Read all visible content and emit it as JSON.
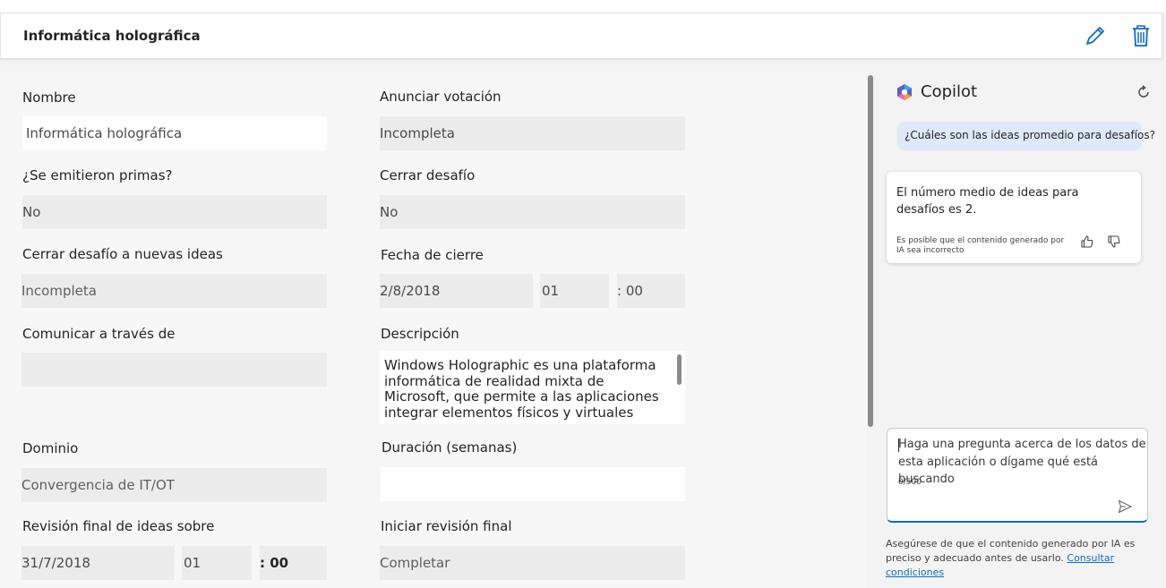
{
  "header": {
    "title": "Informática holográfica",
    "edit_icon": "pencil-icon",
    "delete_icon": "trash-icon",
    "accent": "#0f6cbd"
  },
  "form": {
    "nombre": {
      "label": "Nombre",
      "value": "Informática holográfica"
    },
    "anunciar_votacion": {
      "label": "Anunciar votación",
      "value": "Incompleta"
    },
    "primas": {
      "label": "¿Se emitieron primas?",
      "value": "No"
    },
    "cerrar_desafio": {
      "label": "Cerrar desafío",
      "value": "No"
    },
    "cerrar_nuevas_ideas": {
      "label": "Cerrar desafío a nuevas ideas",
      "value": "Incompleta"
    },
    "fecha_cierre": {
      "label": "Fecha de cierre",
      "date": "2/8/2018",
      "hour": "01",
      "minute": ": 00"
    },
    "comunicar": {
      "label": "Comunicar a través de",
      "value": ""
    },
    "descripcion": {
      "label": "Descripción",
      "value": "Windows Holographic es una plataforma informática de realidad mixta de Microsoft, que permite a las aplicaciones integrar elementos físicos y virtuales"
    },
    "dominio": {
      "label": "Dominio",
      "value": "Convergencia de IT/OT"
    },
    "duracion": {
      "label": "Duración (semanas)",
      "value": ""
    },
    "revision_final": {
      "label": "Revisión final de ideas sobre",
      "date": "31/7/2018",
      "hour": "01",
      "minute": ": 00"
    },
    "iniciar_revision": {
      "label": "Iniciar revisión final",
      "value": "Completar"
    }
  },
  "copilot": {
    "title": "Copilot",
    "user_question": "¿Cuáles son las ideas promedio para desafíos?",
    "answer": "El número medio de ideas para desafíos es 2.",
    "disclaimer": "Es posible que el contenido generado por IA sea incorrecto",
    "input_placeholder": "Haga una pregunta acerca de los datos de esta aplicación o dígame qué está buscando",
    "counter": "0/500",
    "footer_text": "Asegúrese de que el contenido generado por IA es preciso y adecuado antes de usarlo.",
    "footer_link": "Consultar condiciones"
  }
}
